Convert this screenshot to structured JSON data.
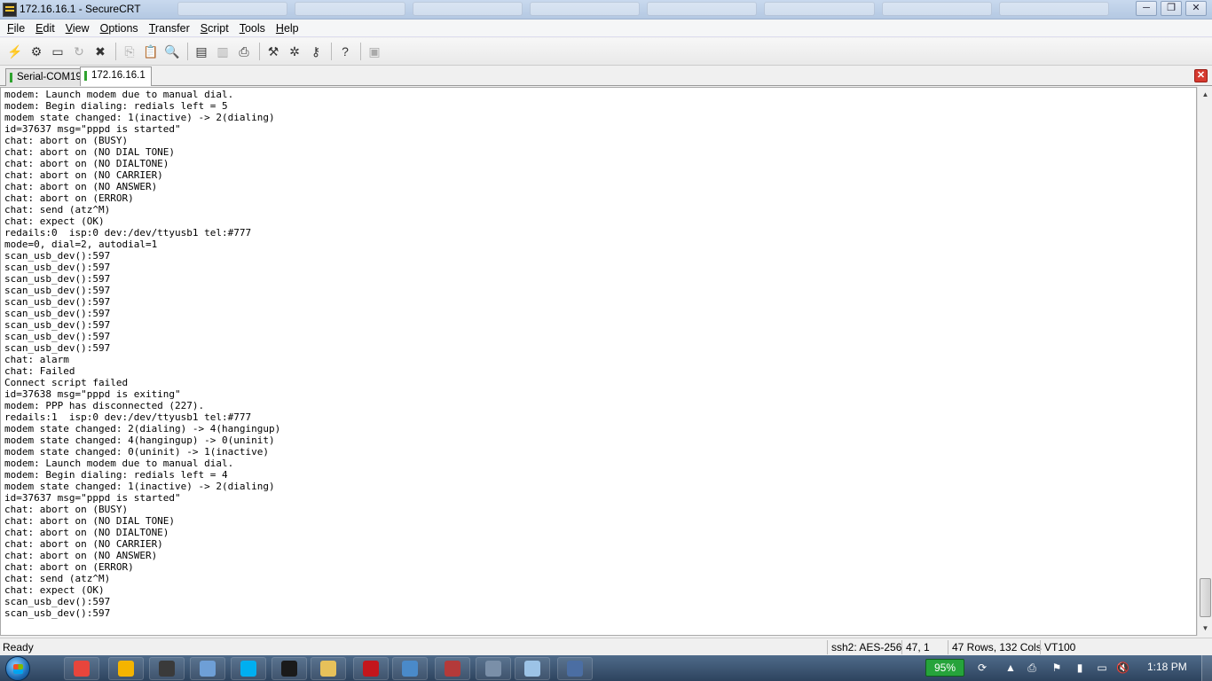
{
  "window": {
    "title": "172.16.16.1 - SecureCRT"
  },
  "window_controls": {
    "minimize": "─",
    "maximize": "❐",
    "close": "✕"
  },
  "menu": [
    "File",
    "Edit",
    "View",
    "Options",
    "Transfer",
    "Script",
    "Tools",
    "Help"
  ],
  "tabs": [
    {
      "label": "Serial-COM19",
      "active": false
    },
    {
      "label": "172.16.16.1",
      "active": true
    }
  ],
  "tab_close": "✕",
  "terminal_lines": [
    "modem: Launch modem due to manual dial.",
    "modem: Begin dialing: redials left = 5",
    "modem state changed: 1(inactive) -> 2(dialing)",
    "id=37637 msg=\"pppd is started\"",
    "chat: abort on (BUSY)",
    "chat: abort on (NO DIAL TONE)",
    "chat: abort on (NO DIALTONE)",
    "chat: abort on (NO CARRIER)",
    "chat: abort on (NO ANSWER)",
    "chat: abort on (ERROR)",
    "chat: send (atz^M)",
    "chat: expect (OK)",
    "redails:0  isp:0 dev:/dev/ttyusb1 tel:#777",
    "mode=0, dial=2, autodial=1",
    "scan_usb_dev():597",
    "scan_usb_dev():597",
    "scan_usb_dev():597",
    "scan_usb_dev():597",
    "scan_usb_dev():597",
    "scan_usb_dev():597",
    "scan_usb_dev():597",
    "scan_usb_dev():597",
    "scan_usb_dev():597",
    "chat: alarm",
    "chat: Failed",
    "Connect script failed",
    "id=37638 msg=\"pppd is exiting\"",
    "modem: PPP has disconnected (227).",
    "redails:1  isp:0 dev:/dev/ttyusb1 tel:#777",
    "modem state changed: 2(dialing) -> 4(hangingup)",
    "modem state changed: 4(hangingup) -> 0(uninit)",
    "modem state changed: 0(uninit) -> 1(inactive)",
    "modem: Launch modem due to manual dial.",
    "modem: Begin dialing: redials left = 4",
    "modem state changed: 1(inactive) -> 2(dialing)",
    "id=37637 msg=\"pppd is started\"",
    "chat: abort on (BUSY)",
    "chat: abort on (NO DIAL TONE)",
    "chat: abort on (NO DIALTONE)",
    "chat: abort on (NO CARRIER)",
    "chat: abort on (NO ANSWER)",
    "chat: abort on (ERROR)",
    "chat: send (atz^M)",
    "chat: expect (OK)",
    "scan_usb_dev():597",
    "scan_usb_dev():597"
  ],
  "status": {
    "ready": "Ready",
    "cipher": "ssh2: AES-256",
    "cursor": "47,  1",
    "size": "47 Rows, 132 Cols",
    "emulation": "VT100"
  },
  "taskbar": {
    "battery": "95%",
    "clock": "1:18 PM",
    "apps": [
      {
        "name": "chrome",
        "color": "#e8453c"
      },
      {
        "name": "outlook",
        "color": "#f5b400"
      },
      {
        "name": "securecrt",
        "color": "#3a3a3a"
      },
      {
        "name": "document",
        "color": "#6e9fd6"
      },
      {
        "name": "skype",
        "color": "#00aff0"
      },
      {
        "name": "command-prompt",
        "color": "#1a1a1a"
      },
      {
        "name": "file-explorer",
        "color": "#e7c15a"
      },
      {
        "name": "acrobat",
        "color": "#c4161c"
      },
      {
        "name": "remote-desktop",
        "color": "#4a8ac9"
      },
      {
        "name": "media-app",
        "color": "#b43a3a"
      },
      {
        "name": "network-tool",
        "color": "#7a8fa8"
      },
      {
        "name": "notepad",
        "color": "#9cc3e6"
      },
      {
        "name": "putty",
        "color": "#4b6ea3"
      }
    ]
  }
}
